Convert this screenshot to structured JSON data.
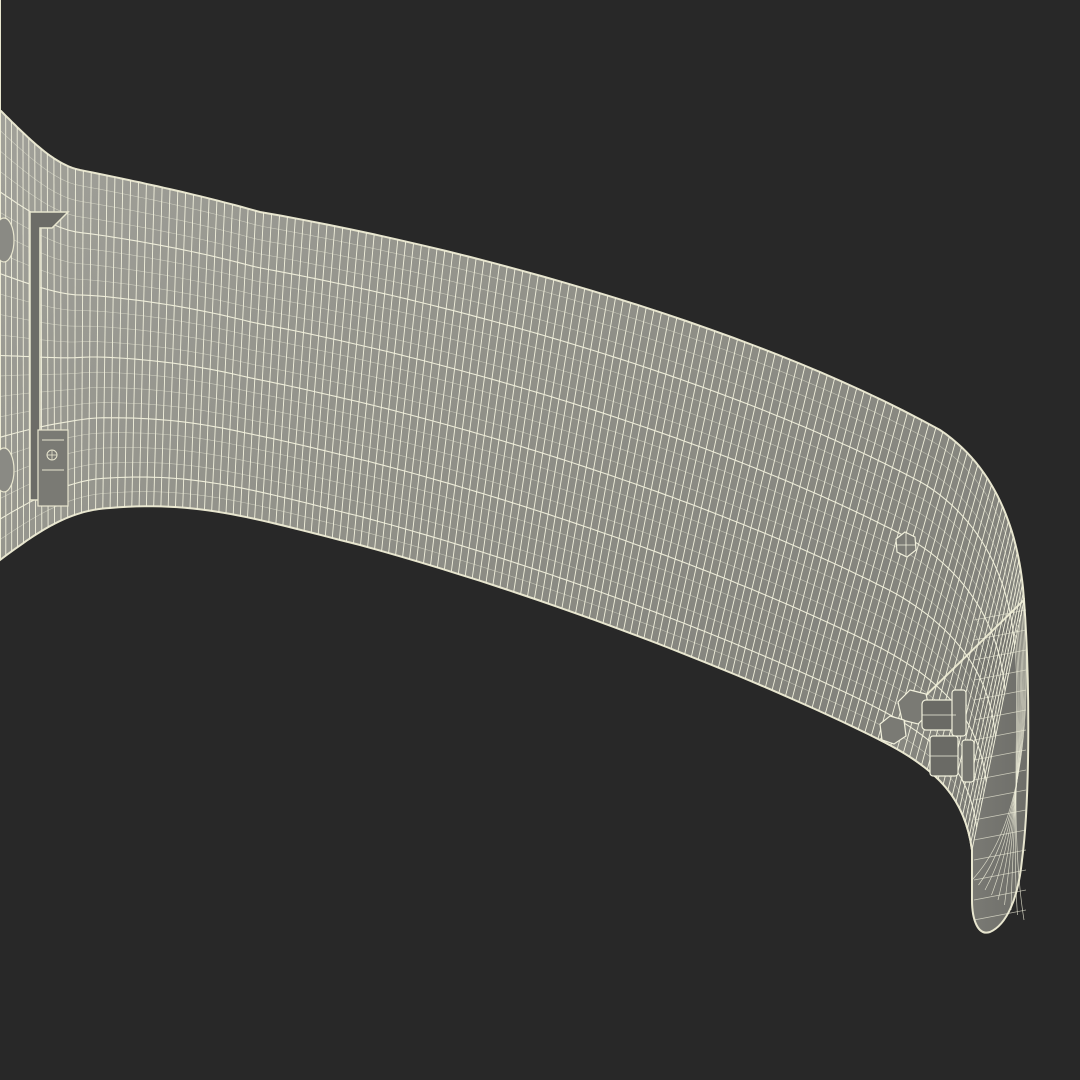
{
  "scene": {
    "subject": "wireframe-band-model",
    "colors": {
      "background": "#282828",
      "surface": "#8f8f89",
      "surface_light": "#a6a69f",
      "surface_dark": "#6f6f6a",
      "wire": "#f1f0dc",
      "wire_shadow": "#4a4a46",
      "outline": "#e8e6cf"
    }
  }
}
